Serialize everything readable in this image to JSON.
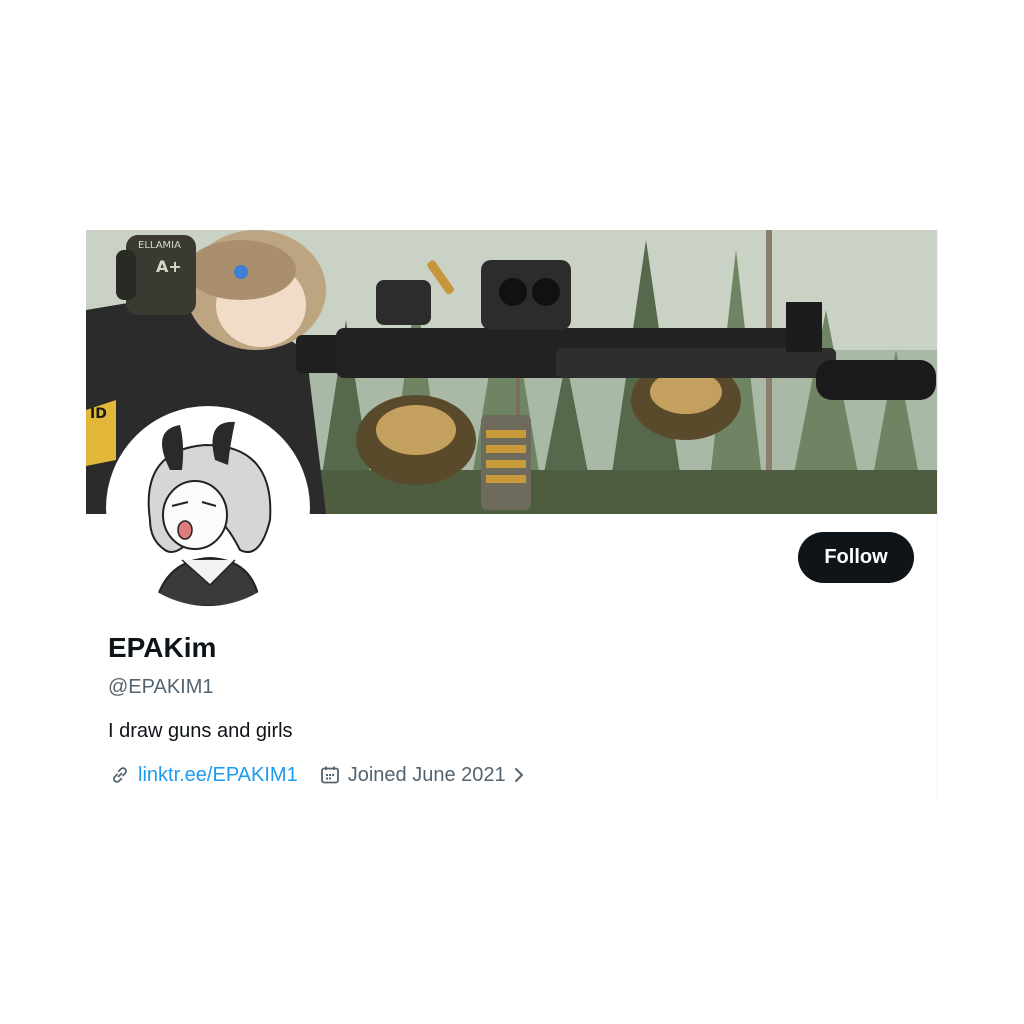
{
  "profile": {
    "display_name": "EPAKim",
    "handle": "@EPAKIM1",
    "bio": "I draw guns and girls",
    "website": "linktr.ee/EPAKIM1",
    "joined": "Joined June 2021",
    "banner_patches": {
      "left_patch": "ELLAMIA",
      "blood_type": "A+",
      "id_patch": "ID"
    }
  },
  "actions": {
    "follow_label": "Follow"
  },
  "icons": {
    "website": "link-icon",
    "joined": "calendar-icon",
    "expand": "chevron-right-icon"
  },
  "colors": {
    "button_bg": "#0f1419",
    "link": "#1d9bf0",
    "secondary_text": "#536471",
    "primary_text": "#0f1419"
  }
}
